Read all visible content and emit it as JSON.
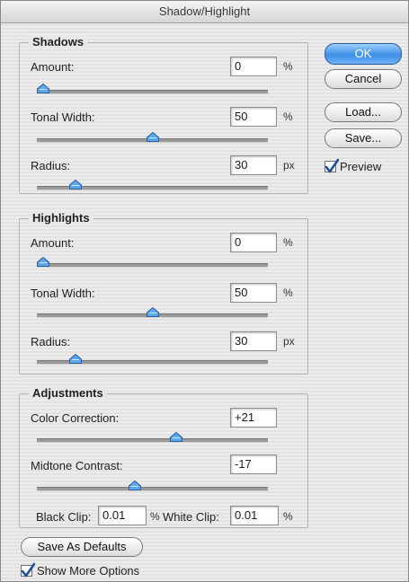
{
  "window": {
    "title": "Shadow/Highlight"
  },
  "shadows": {
    "title": "Shadows",
    "amount": {
      "label": "Amount:",
      "value": "0",
      "unit": "%",
      "slider_fraction": 0.0
    },
    "tonal_width": {
      "label": "Tonal Width:",
      "value": "50",
      "unit": "%",
      "slider_fraction": 0.5
    },
    "radius": {
      "label": "Radius:",
      "value": "30",
      "unit": "px",
      "slider_fraction": 0.15
    }
  },
  "highlights": {
    "title": "Highlights",
    "amount": {
      "label": "Amount:",
      "value": "0",
      "unit": "%",
      "slider_fraction": 0.0
    },
    "tonal_width": {
      "label": "Tonal Width:",
      "value": "50",
      "unit": "%",
      "slider_fraction": 0.5
    },
    "radius": {
      "label": "Radius:",
      "value": "30",
      "unit": "px",
      "slider_fraction": 0.15
    }
  },
  "adjustments": {
    "title": "Adjustments",
    "color_correction": {
      "label": "Color Correction:",
      "value": "+21",
      "slider_fraction": 0.61
    },
    "midtone_contrast": {
      "label": "Midtone Contrast:",
      "value": "-17",
      "slider_fraction": 0.42
    },
    "black_clip": {
      "label": "Black Clip:",
      "value": "0.01",
      "unit": "%"
    },
    "white_clip": {
      "label": "White Clip:",
      "value": "0.01",
      "unit": "%"
    }
  },
  "buttons": {
    "ok": "OK",
    "cancel": "Cancel",
    "load": "Load...",
    "save": "Save...",
    "save_defaults": "Save As Defaults"
  },
  "preview": {
    "label": "Preview",
    "checked": true
  },
  "show_more": {
    "label": "Show More Options",
    "checked": true
  },
  "colors": {
    "accent": "#3d8ee6",
    "thumb": "#5aa7ee",
    "background": "#e8e8e8"
  }
}
